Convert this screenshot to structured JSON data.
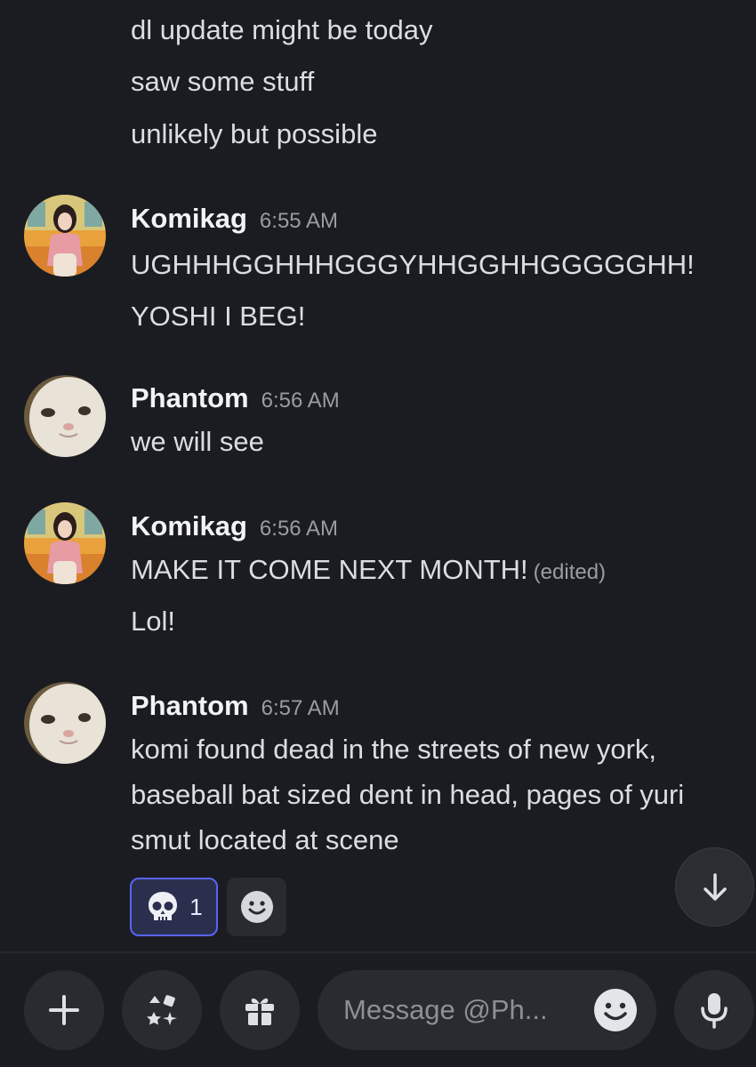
{
  "messages": [
    {
      "author": null,
      "time": null,
      "lines": [
        "dl update might be today",
        "saw some stuff",
        "unlikely but possible"
      ]
    },
    {
      "author": "Komikag",
      "time": "6:55 AM",
      "avatar": "komikag-avatar",
      "lines": [
        "UGHHHGGHHHGGGYHHGGHHGGGGGHH!",
        "YOSHI I BEG!"
      ]
    },
    {
      "author": "Phantom",
      "time": "6:56 AM",
      "avatar": "phantom-cat-avatar",
      "lines": [
        "we will see"
      ]
    },
    {
      "author": "Komikag",
      "time": "6:56 AM",
      "avatar": "komikag-avatar",
      "lines": [
        "MAKE IT COME NEXT MONTH!",
        "Lol!"
      ],
      "edited_label": "(edited)"
    },
    {
      "author": "Phantom",
      "time": "6:57 AM",
      "avatar": "phantom-cat-avatar",
      "lines": [
        "komi found dead in the streets of new york,",
        "baseball bat sized dent in head, pages of yuri",
        "smut located at scene"
      ],
      "reactions": [
        {
          "icon": "skull-icon",
          "count": "1",
          "selected": true
        }
      ]
    }
  ],
  "composer": {
    "placeholder": "Message @Ph...",
    "buttons": [
      "plus-icon",
      "apps-icon",
      "gift-icon",
      "emoji-icon",
      "microphone-icon"
    ]
  },
  "colors": {
    "background": "#1b1c21",
    "accent": "#5865f2",
    "text": "#dcdde1",
    "muted": "#9a9ca3"
  }
}
